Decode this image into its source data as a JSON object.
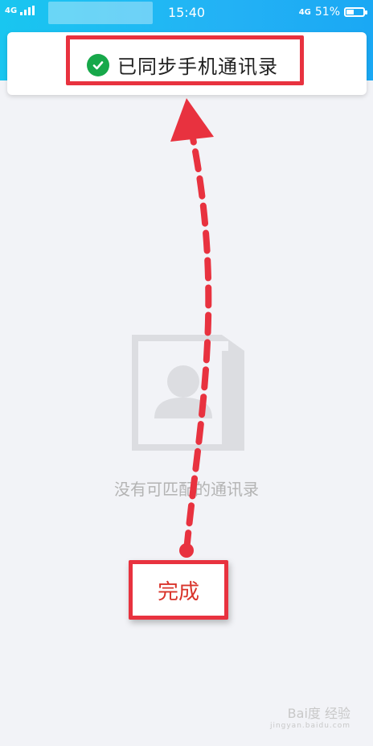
{
  "status_bar": {
    "network": "4G",
    "time": "15:40",
    "right_network": "4G",
    "battery": "51%",
    "battery_level": 0.51
  },
  "toast": {
    "icon": "check-circle-icon",
    "text": "已同步手机通讯录"
  },
  "empty_state": {
    "icon": "contact-card-icon",
    "text": "没有可匹配的通讯录"
  },
  "annotation": {
    "done_label": "完成"
  },
  "watermark": {
    "logo_text": "Bai度 经验",
    "sub": "jingyan.baidu.com"
  },
  "colors": {
    "header_gradient_start": "#19c6f0",
    "header_gradient_end": "#1aa8f4",
    "annotation_red": "#e8323f",
    "check_green": "#17a84a",
    "background": "#f2f3f7"
  }
}
